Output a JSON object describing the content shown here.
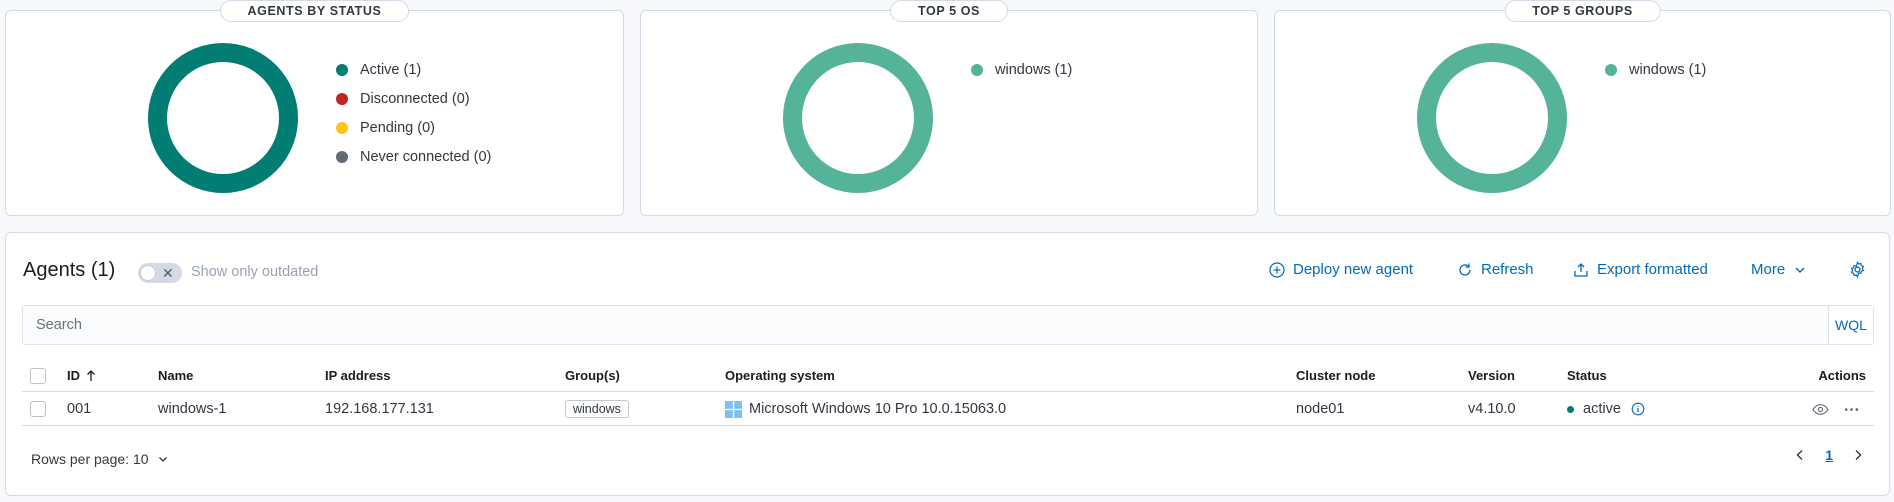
{
  "panels": {
    "status": {
      "title": "AGENTS BY STATUS",
      "legend": [
        {
          "label": "Active (1)",
          "color": "#017d73"
        },
        {
          "label": "Disconnected (0)",
          "color": "#bd271e"
        },
        {
          "label": "Pending (0)",
          "color": "#fec514"
        },
        {
          "label": "Never connected (0)",
          "color": "#646a77"
        }
      ],
      "donut_color": "#017d73"
    },
    "os": {
      "title": "TOP 5 OS",
      "legend": [
        {
          "label": "windows (1)",
          "color": "#54b399"
        }
      ],
      "donut_color": "#54b399"
    },
    "groups": {
      "title": "TOP 5 GROUPS",
      "legend": [
        {
          "label": "windows (1)",
          "color": "#54b399"
        }
      ],
      "donut_color": "#54b399"
    }
  },
  "agents": {
    "title": "Agents (1)",
    "toggle_label": "Show only outdated",
    "toggle_on": false,
    "actions": {
      "deploy": "Deploy new agent",
      "refresh": "Refresh",
      "export": "Export formatted",
      "more": "More"
    },
    "search": {
      "placeholder": "Search",
      "value": "",
      "wql": "WQL"
    },
    "columns": {
      "id": "ID",
      "name": "Name",
      "ip": "IP address",
      "groups": "Group(s)",
      "os": "Operating system",
      "node": "Cluster node",
      "version": "Version",
      "status": "Status",
      "actions": "Actions"
    },
    "rows": [
      {
        "id": "001",
        "name": "windows-1",
        "ip": "192.168.177.131",
        "group": "windows",
        "os": "Microsoft Windows 10 Pro 10.0.15063.0",
        "node": "node01",
        "version": "v4.10.0",
        "status": "active"
      }
    ],
    "rows_per_page": "Rows per page: 10",
    "current_page": "1"
  }
}
